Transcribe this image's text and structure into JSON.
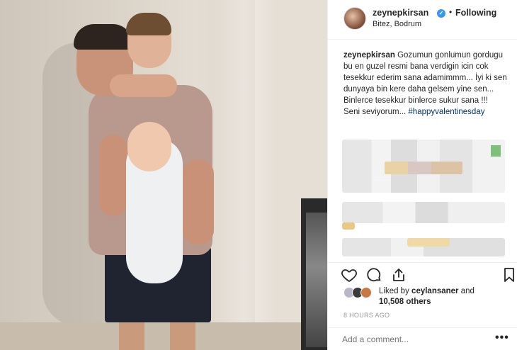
{
  "post": {
    "username": "zeynepkirsan",
    "follow_status": "Following",
    "location": "Bitez, Bodrum",
    "caption_user": "zeynepkirsan",
    "caption_line1": "Gozumun gonlumun gordugu bu en guzel resmi bana verdigin icin cok tesekkur ederim sana adamimmm... İyi ki sen dunyaya bin kere daha gelsem yine sen... Binlerce tesekkur binlerce sukur sana !!!",
    "caption_line2": "Seni seviyorum...",
    "hashtag": "#happyvalentinesday",
    "liked_by_prefix": "Liked by",
    "liked_by_user": "ceylansaner",
    "liked_by_and": "and",
    "liked_by_count": "10,508 others",
    "time_ago": "8 HOURS AGO",
    "comment_placeholder": "Add a comment...",
    "more_label": "•••"
  },
  "icons": {
    "verified": "verified-badge-icon",
    "like": "heart-icon",
    "comment": "comment-bubble-icon",
    "share": "share-icon",
    "save": "bookmark-icon"
  },
  "colors": {
    "verified": "#3897f0",
    "hashtag": "#003569",
    "muted": "#999999"
  }
}
